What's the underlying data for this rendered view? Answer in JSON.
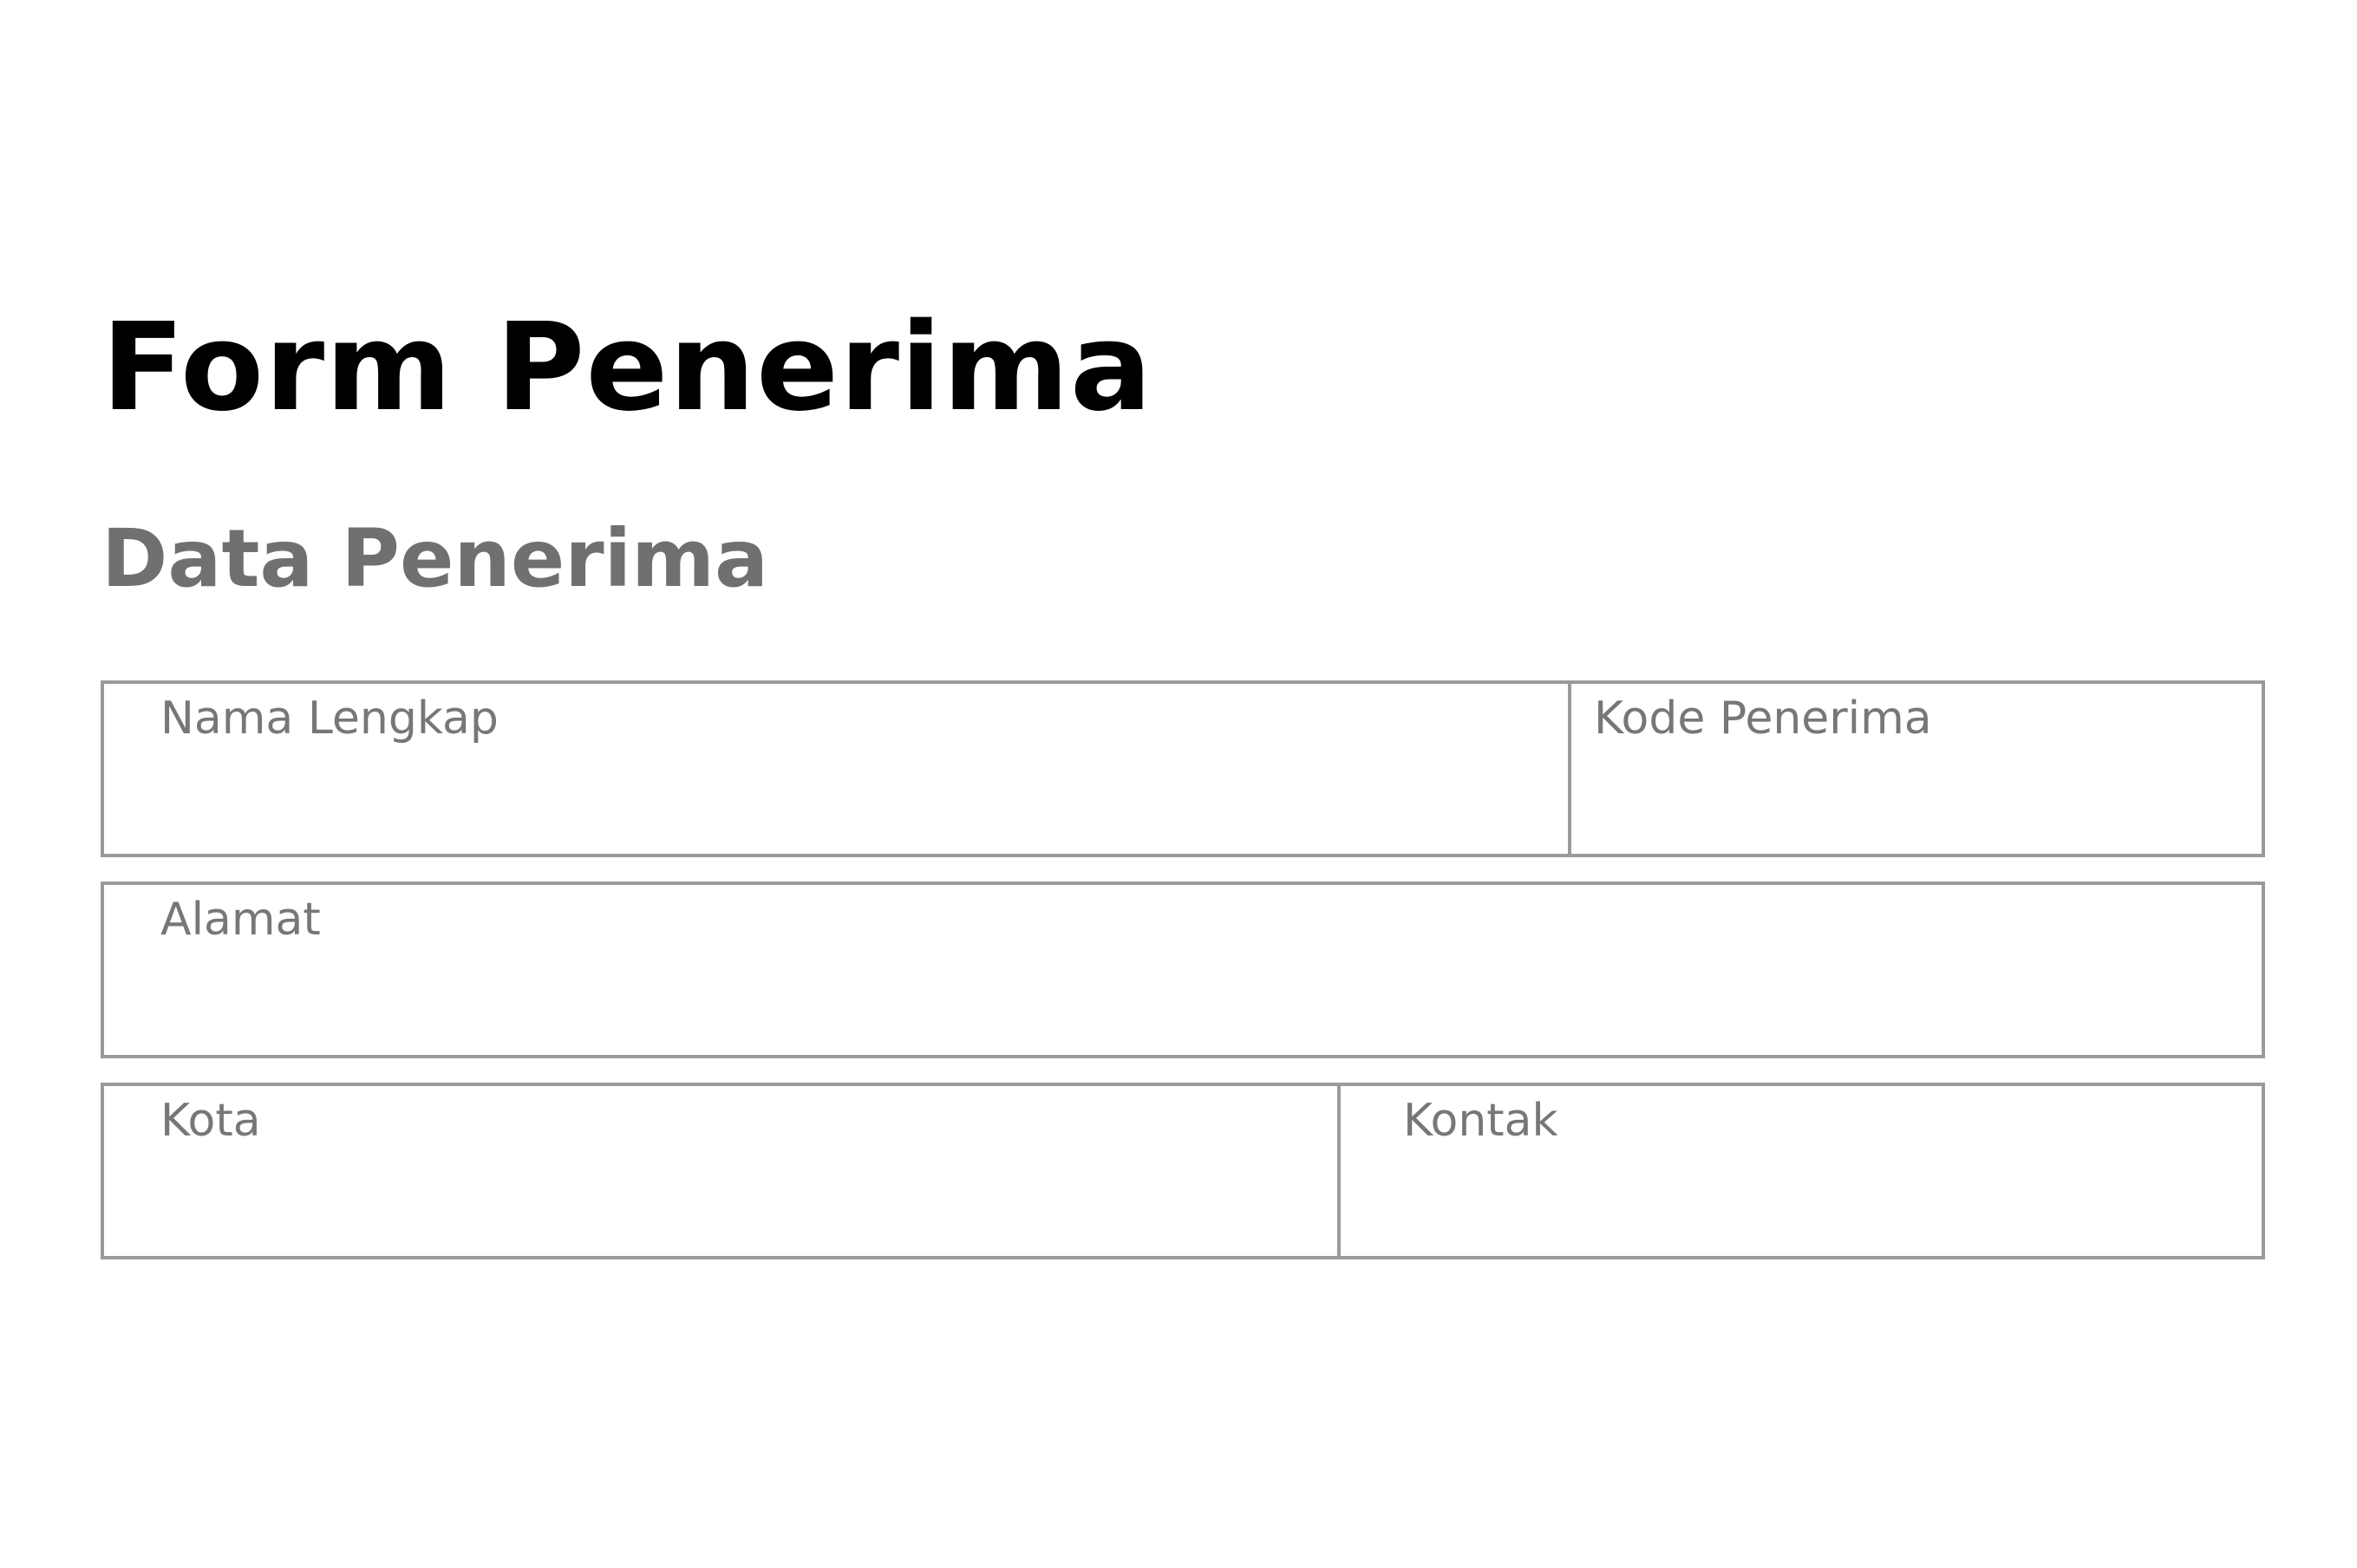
{
  "form": {
    "title": "Form Penerima",
    "section_title": "Data Penerima",
    "fields": {
      "nama_lengkap": {
        "label": "Nama Lengkap",
        "value": ""
      },
      "kode_penerima": {
        "label": "Kode Penerima",
        "value": ""
      },
      "alamat": {
        "label": "Alamat",
        "value": ""
      },
      "kota": {
        "label": "Kota",
        "value": ""
      },
      "kontak": {
        "label": "Kontak",
        "value": ""
      }
    }
  },
  "colors": {
    "title": "#000000",
    "section_title": "#707070",
    "border": "#9a9a9a",
    "label": "#777777",
    "background": "#ffffff"
  }
}
